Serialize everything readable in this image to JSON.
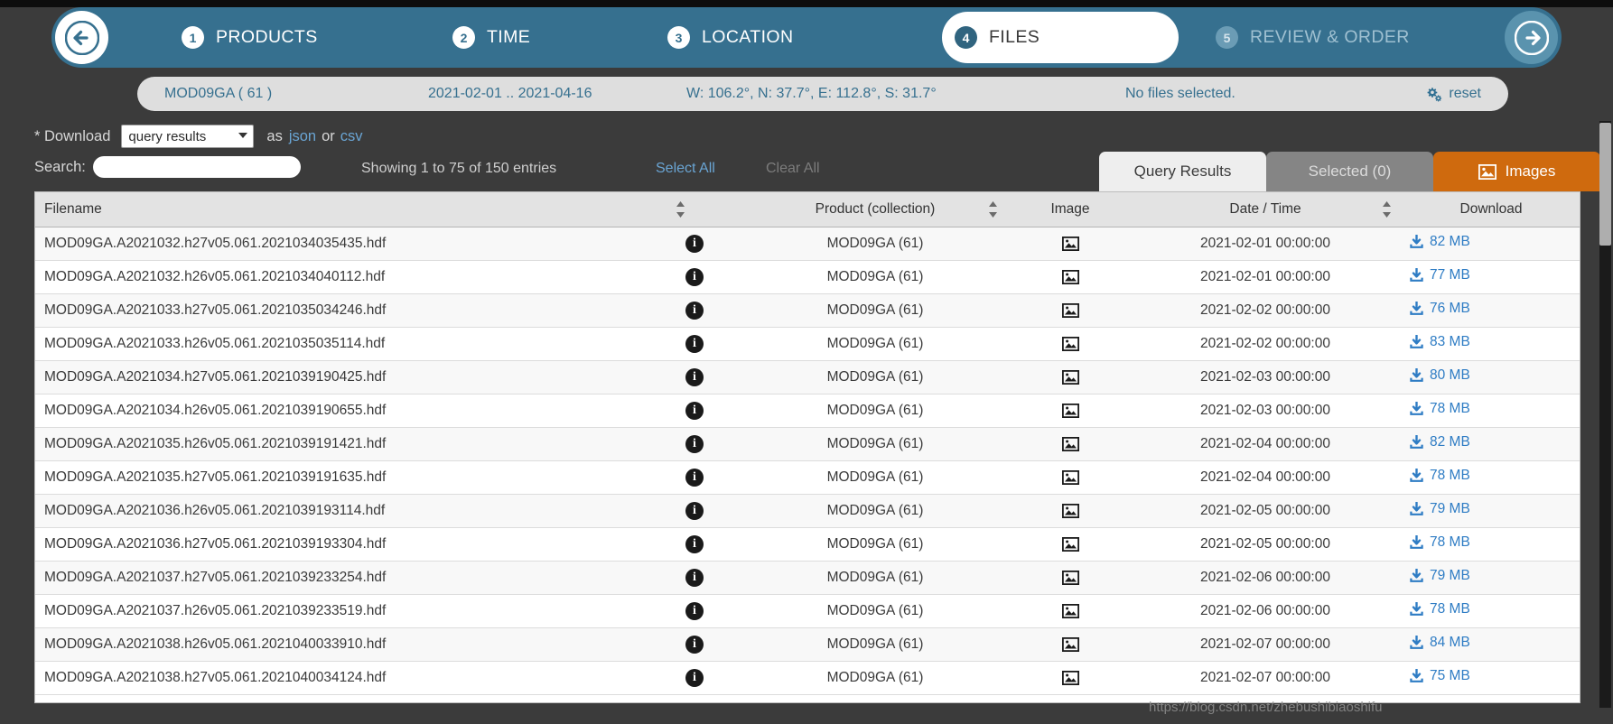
{
  "wizard": {
    "back_icon": "arrow-left-icon",
    "forward_icon": "arrow-right-icon",
    "steps": [
      {
        "num": "1",
        "label": "PRODUCTS",
        "state": "done"
      },
      {
        "num": "2",
        "label": "TIME",
        "state": "done"
      },
      {
        "num": "3",
        "label": "LOCATION",
        "state": "done"
      },
      {
        "num": "4",
        "label": "FILES",
        "state": "active"
      },
      {
        "num": "5",
        "label": "REVIEW & ORDER",
        "state": "disabled"
      }
    ]
  },
  "breadcrumb": {
    "product": "MOD09GA ( 61 )",
    "time": "2021-02-01 .. 2021-04-16",
    "location": "W: 106.2°, N: 37.7°, E: 112.8°, S: 31.7°",
    "files": "No files selected.",
    "reset_label": "reset",
    "reset_icon": "gears-icon"
  },
  "download_bar": {
    "label": "* Download",
    "select_value": "query results",
    "select_options": [
      "query results"
    ],
    "as_word": "as",
    "json_link": "json",
    "or_word": "or",
    "csv_link": "csv"
  },
  "search": {
    "label": "Search:",
    "value": "",
    "placeholder": ""
  },
  "status": {
    "showing": "Showing 1 to 75 of 150 entries",
    "select_all": "Select All",
    "clear_all": "Clear All"
  },
  "tabs": [
    {
      "label": "Query Results",
      "state": "active"
    },
    {
      "label": "Selected (0)",
      "state": "inactive"
    },
    {
      "label": "Images",
      "state": "images",
      "icon": "image-icon"
    }
  ],
  "table": {
    "columns": [
      {
        "key": "filename",
        "label": "Filename",
        "sortable": false
      },
      {
        "key": "info",
        "label": "",
        "sortable": true
      },
      {
        "key": "product",
        "label": "Product (collection)",
        "sortable": true
      },
      {
        "key": "image",
        "label": "Image",
        "sortable": false
      },
      {
        "key": "date",
        "label": "Date / Time",
        "sortable": true
      },
      {
        "key": "download",
        "label": "Download",
        "sortable": false
      }
    ],
    "rows": [
      {
        "filename": "MOD09GA.A2021032.h27v05.061.2021034035435.hdf",
        "product": "MOD09GA (61)",
        "date": "2021-02-01 00:00:00",
        "size": "82 MB"
      },
      {
        "filename": "MOD09GA.A2021032.h26v05.061.2021034040112.hdf",
        "product": "MOD09GA (61)",
        "date": "2021-02-01 00:00:00",
        "size": "77 MB"
      },
      {
        "filename": "MOD09GA.A2021033.h27v05.061.2021035034246.hdf",
        "product": "MOD09GA (61)",
        "date": "2021-02-02 00:00:00",
        "size": "76 MB"
      },
      {
        "filename": "MOD09GA.A2021033.h26v05.061.2021035035114.hdf",
        "product": "MOD09GA (61)",
        "date": "2021-02-02 00:00:00",
        "size": "83 MB"
      },
      {
        "filename": "MOD09GA.A2021034.h27v05.061.2021039190425.hdf",
        "product": "MOD09GA (61)",
        "date": "2021-02-03 00:00:00",
        "size": "80 MB"
      },
      {
        "filename": "MOD09GA.A2021034.h26v05.061.2021039190655.hdf",
        "product": "MOD09GA (61)",
        "date": "2021-02-03 00:00:00",
        "size": "78 MB"
      },
      {
        "filename": "MOD09GA.A2021035.h26v05.061.2021039191421.hdf",
        "product": "MOD09GA (61)",
        "date": "2021-02-04 00:00:00",
        "size": "82 MB"
      },
      {
        "filename": "MOD09GA.A2021035.h27v05.061.2021039191635.hdf",
        "product": "MOD09GA (61)",
        "date": "2021-02-04 00:00:00",
        "size": "78 MB"
      },
      {
        "filename": "MOD09GA.A2021036.h26v05.061.2021039193114.hdf",
        "product": "MOD09GA (61)",
        "date": "2021-02-05 00:00:00",
        "size": "79 MB"
      },
      {
        "filename": "MOD09GA.A2021036.h27v05.061.2021039193304.hdf",
        "product": "MOD09GA (61)",
        "date": "2021-02-05 00:00:00",
        "size": "78 MB"
      },
      {
        "filename": "MOD09GA.A2021037.h27v05.061.2021039233254.hdf",
        "product": "MOD09GA (61)",
        "date": "2021-02-06 00:00:00",
        "size": "79 MB"
      },
      {
        "filename": "MOD09GA.A2021037.h26v05.061.2021039233519.hdf",
        "product": "MOD09GA (61)",
        "date": "2021-02-06 00:00:00",
        "size": "78 MB"
      },
      {
        "filename": "MOD09GA.A2021038.h26v05.061.2021040033910.hdf",
        "product": "MOD09GA (61)",
        "date": "2021-02-07 00:00:00",
        "size": "84 MB"
      },
      {
        "filename": "MOD09GA.A2021038.h27v05.061.2021040034124.hdf",
        "product": "MOD09GA (61)",
        "date": "2021-02-07 00:00:00",
        "size": "75 MB"
      }
    ],
    "info_glyph": "i",
    "info_icon": "info-icon",
    "image_icon": "image-thumbnail-icon",
    "download_icon": "download-icon"
  },
  "watermark": "https://blog.csdn.net/zhebushibiaoshifu",
  "colors": {
    "wizard_blue": "#36708f",
    "page_dark": "#3b3b3b",
    "link_blue": "#6aa5d4",
    "download_blue": "#2e7cc4",
    "images_orange": "#cf6a0e",
    "crumb_bg": "#dedede"
  }
}
